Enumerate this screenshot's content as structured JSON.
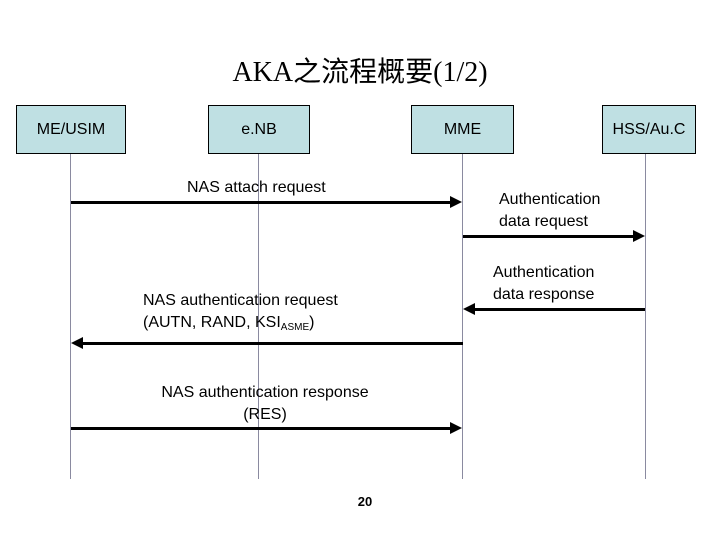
{
  "title": "AKA之流程概要(1/2)",
  "entities": [
    {
      "id": "me_usim",
      "label": "ME/USIM"
    },
    {
      "id": "enb",
      "label": "e.NB"
    },
    {
      "id": "mme",
      "label": "MME"
    },
    {
      "id": "hss_auc",
      "label": "HSS/Au.C"
    }
  ],
  "colors": {
    "entity_box": "#bfe0e3",
    "lifeline": "#8a8aa0",
    "arrow": "#000000"
  },
  "messages": [
    {
      "from": "ME/USIM",
      "to": "MME",
      "label": "NAS attach request"
    },
    {
      "from": "MME",
      "to": "HSS/Au.C",
      "label_line1": "Authentication",
      "label_line2": "data request"
    },
    {
      "from": "HSS/Au.C",
      "to": "MME",
      "label_line1": "Authentication",
      "label_line2": "data response"
    },
    {
      "from": "MME",
      "to": "ME/USIM",
      "label_line1": "NAS authentication request",
      "label_line2_prefix": "(AUTN, RAND, KSI",
      "label_line2_sub": "ASME",
      "label_line2_suffix": ")"
    },
    {
      "from": "ME/USIM",
      "to": "MME",
      "label_line1": "NAS authentication response",
      "label_line2": "(RES)"
    }
  ],
  "page_number": "20"
}
